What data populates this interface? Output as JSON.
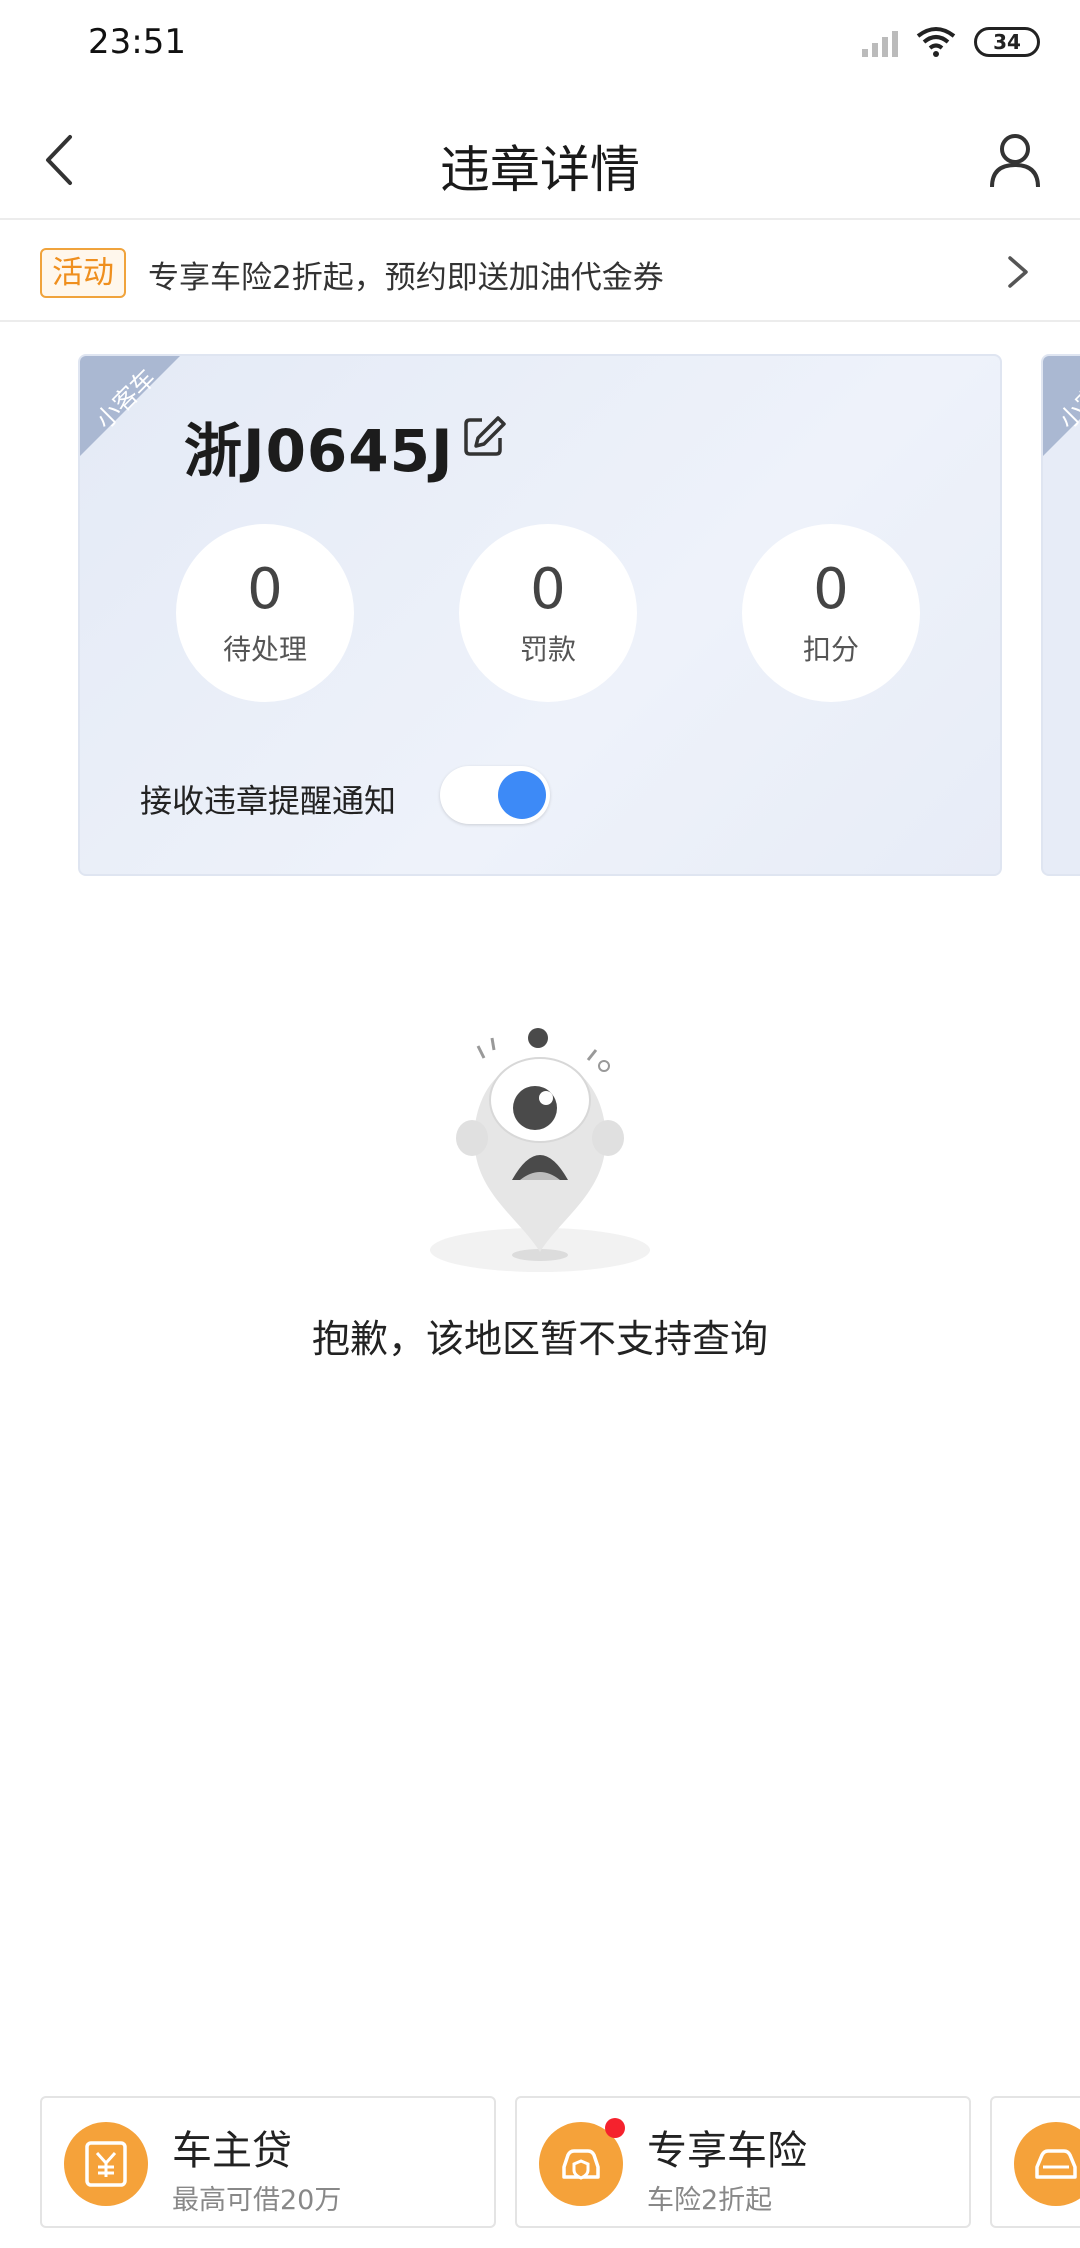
{
  "status_bar": {
    "time": "23:51",
    "battery": "34"
  },
  "nav": {
    "title": "违章详情"
  },
  "promo": {
    "tag": "活动",
    "text": "专享车险2折起，预约即送加油代金券"
  },
  "car_card": {
    "type_label": "小客车",
    "plate": "浙J0645J",
    "stats": [
      {
        "value": "0",
        "label": "待处理"
      },
      {
        "value": "0",
        "label": "罚款"
      },
      {
        "value": "0",
        "label": "扣分"
      }
    ],
    "notify_label": "接收违章提醒通知",
    "notify_enabled": true
  },
  "next_card": {
    "type_label": "小客车"
  },
  "empty_state": {
    "message": "抱歉，该地区暂不支持查询"
  },
  "services": [
    {
      "title": "车主贷",
      "subtitle": "最高可借20万"
    },
    {
      "title": "专享车险",
      "subtitle": "车险2折起"
    }
  ],
  "colors": {
    "accent_blue": "#3d8af7",
    "promo_orange": "#ef8f1e",
    "service_orange": "#f5a23a"
  }
}
